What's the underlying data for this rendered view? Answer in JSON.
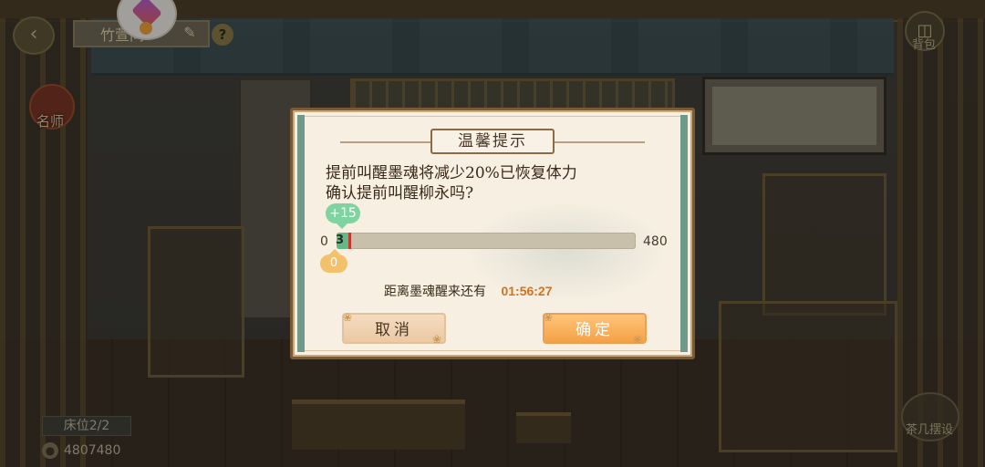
{
  "hud": {
    "title": "竹萱间",
    "famous_label": "名师",
    "bag_label": "背包",
    "bed_status": "床位2/2",
    "coins": "4807480",
    "bottom_right_label": "茶几摆设"
  },
  "dialog": {
    "title": "温馨提示",
    "line1": "提前叫醒墨魂将减少20%已恢复体力",
    "line2": "确认提前叫醒柳永吗?",
    "gain_badge": "+15",
    "bar_min": "0",
    "bar_current": "3",
    "bar_max": "480",
    "bar_fill_fraction": 0.014,
    "cost_badge": "0",
    "wake_label": "距离墨魂醒来还有",
    "wake_time": "01:56:27",
    "cancel_label": "取消",
    "confirm_label": "确定"
  },
  "colors": {
    "accent_green": "#63b884",
    "accent_orange": "#f4a246",
    "cost_red": "#c9362d",
    "timer_orange": "#d0731f"
  }
}
